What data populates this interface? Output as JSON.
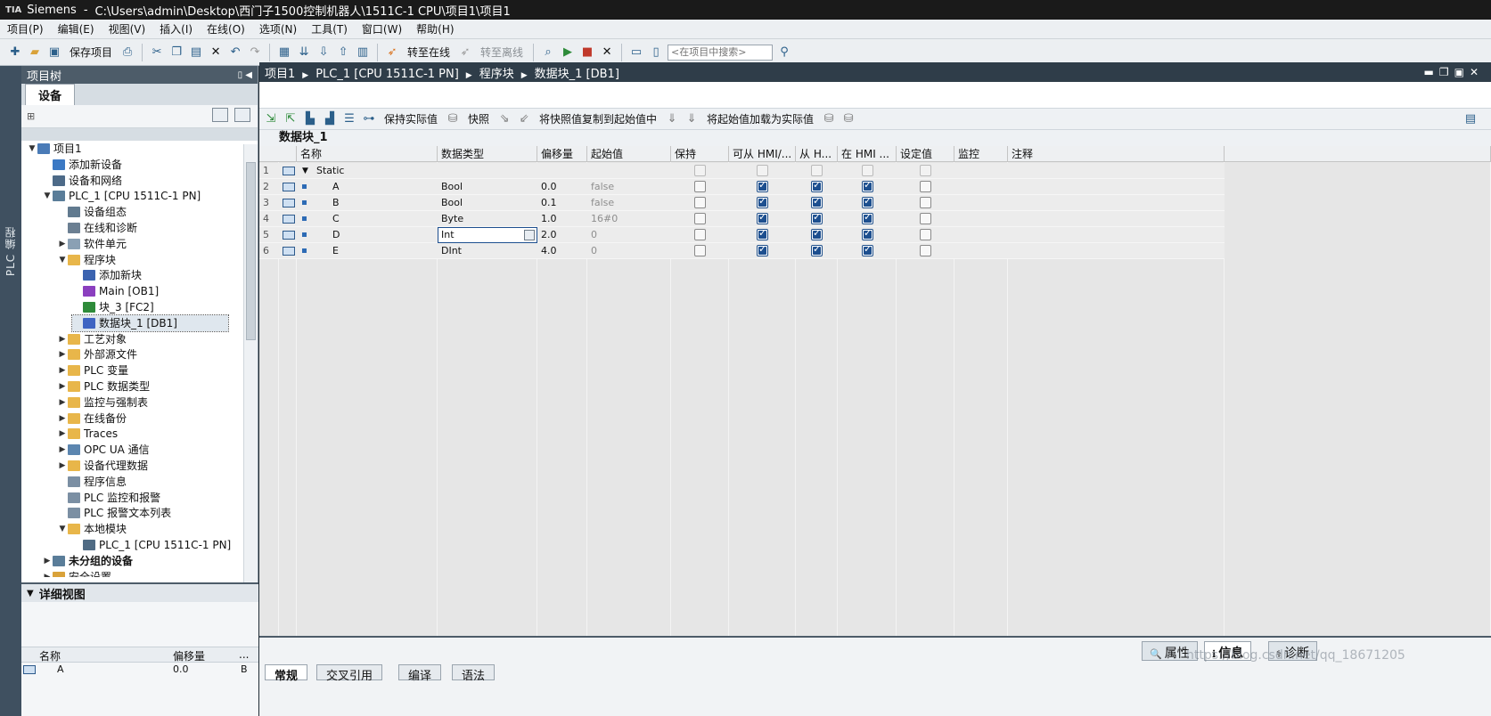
{
  "window": {
    "app": "Siemens",
    "path": "C:\\Users\\admin\\Desktop\\西门子1500控制机器人\\1511C-1 CPU\\项目1\\项目1"
  },
  "menu": [
    "项目(P)",
    "编辑(E)",
    "视图(V)",
    "插入(I)",
    "在线(O)",
    "选项(N)",
    "工具(T)",
    "窗口(W)",
    "帮助(H)"
  ],
  "toolbar": {
    "save_label": "保存项目",
    "go_online": "转至在线",
    "go_offline": "转至离线",
    "search_placeholder": "<在项目中搜索>"
  },
  "vertical_tab": "PLC 编程",
  "tree": {
    "title": "项目树",
    "tab": "设备",
    "items": [
      {
        "label": "项目1",
        "level": 0,
        "expander": "▼",
        "icon": "project-icon",
        "color": "#4a7bb7"
      },
      {
        "label": "添加新设备",
        "level": 1,
        "expander": "",
        "icon": "add-device-icon",
        "color": "#3b79c4"
      },
      {
        "label": "设备和网络",
        "level": 1,
        "expander": "",
        "icon": "network-icon",
        "color": "#4d6a88"
      },
      {
        "label": "PLC_1 [CPU 1511C-1 PN]",
        "level": 1,
        "expander": "▼",
        "icon": "plc-icon",
        "color": "#5a7d99"
      },
      {
        "label": "设备组态",
        "level": 2,
        "expander": "",
        "icon": "device-config-icon",
        "color": "#617a8f"
      },
      {
        "label": "在线和诊断",
        "level": 2,
        "expander": "",
        "icon": "diagnostics-icon",
        "color": "#6b7f92"
      },
      {
        "label": "软件单元",
        "level": 2,
        "expander": "▶",
        "icon": "software-unit-icon",
        "color": "#8aa0b4"
      },
      {
        "label": "程序块",
        "level": 2,
        "expander": "▼",
        "icon": "folder-icon",
        "color": "#e8b64a"
      },
      {
        "label": "添加新块",
        "level": 3,
        "expander": "",
        "icon": "add-block-icon",
        "color": "#3b63b0"
      },
      {
        "label": "Main [OB1]",
        "level": 3,
        "expander": "",
        "icon": "ob-icon",
        "color": "#8b3fbf"
      },
      {
        "label": "块_3 [FC2]",
        "level": 3,
        "expander": "",
        "icon": "fc-icon",
        "color": "#2e8b3a"
      },
      {
        "label": "数据块_1 [DB1]",
        "level": 3,
        "expander": "",
        "icon": "db-icon",
        "color": "#3e64c2"
      },
      {
        "label": "工艺对象",
        "level": 2,
        "expander": "▶",
        "icon": "folder-icon",
        "color": "#e8b64a"
      },
      {
        "label": "外部源文件",
        "level": 2,
        "expander": "▶",
        "icon": "folder-icon",
        "color": "#e8b64a"
      },
      {
        "label": "PLC 变量",
        "level": 2,
        "expander": "▶",
        "icon": "folder-icon",
        "color": "#e8b64a"
      },
      {
        "label": "PLC 数据类型",
        "level": 2,
        "expander": "▶",
        "icon": "folder-icon",
        "color": "#e8b64a"
      },
      {
        "label": "监控与强制表",
        "level": 2,
        "expander": "▶",
        "icon": "folder-icon",
        "color": "#e8b64a"
      },
      {
        "label": "在线备份",
        "level": 2,
        "expander": "▶",
        "icon": "folder-icon",
        "color": "#e8b64a"
      },
      {
        "label": "Traces",
        "level": 2,
        "expander": "▶",
        "icon": "folder-icon",
        "color": "#e8b64a"
      },
      {
        "label": "OPC UA 通信",
        "level": 2,
        "expander": "▶",
        "icon": "opcua-icon",
        "color": "#5c86b0"
      },
      {
        "label": "设备代理数据",
        "level": 2,
        "expander": "▶",
        "icon": "folder-icon",
        "color": "#e8b64a"
      },
      {
        "label": "程序信息",
        "level": 2,
        "expander": "",
        "icon": "program-info-icon",
        "color": "#7b8fa3"
      },
      {
        "label": "PLC 监控和报警",
        "level": 2,
        "expander": "",
        "icon": "alarm-icon",
        "color": "#7b8fa3"
      },
      {
        "label": "PLC 报警文本列表",
        "level": 2,
        "expander": "",
        "icon": "text-list-icon",
        "color": "#7b8fa3"
      },
      {
        "label": "本地模块",
        "level": 2,
        "expander": "▼",
        "icon": "folder-icon",
        "color": "#e8b64a"
      },
      {
        "label": "PLC_1 [CPU 1511C-1 PN]",
        "level": 3,
        "expander": "",
        "icon": "cpu-module-icon",
        "color": "#4f6b84"
      },
      {
        "label": "未分组的设备",
        "level": 1,
        "expander": "▶",
        "icon": "devices-icon",
        "color": "#5a7d99",
        "bold": true
      },
      {
        "label": "安全设置",
        "level": 1,
        "expander": "▶",
        "icon": "security-icon",
        "color": "#d9a23a"
      }
    ]
  },
  "detail": {
    "title": "详细视图",
    "col_name": "名称",
    "col_offset": "偏移量",
    "col_more": "...",
    "row_name": "A",
    "row_offset": "0.0",
    "row_extra": "B"
  },
  "editor": {
    "breadcrumb": [
      "项目1",
      "PLC_1 [CPU 1511C-1 PN]",
      "程序块",
      "数据块_1 [DB1]"
    ],
    "tools": {
      "keep_actual": "保持实际值",
      "snapshot": "快照",
      "copy_snapshot": "将快照值复制到起始值中",
      "load_start": "将起始值加载为实际值"
    },
    "block_title": "数据块_1",
    "columns": [
      "名称",
      "数据类型",
      "偏移量",
      "起始值",
      "保持",
      "可从 HMI/...",
      "从 H...",
      "在 HMI ...",
      "设定值",
      "监控",
      "注释"
    ],
    "rows": [
      {
        "num": "1",
        "name": "Static",
        "type": "",
        "offset": "",
        "start": "",
        "retain": false,
        "hmi_access": false,
        "from_hmi": false,
        "in_hmi": false,
        "setpoint": false,
        "struct": true
      },
      {
        "num": "2",
        "name": "A",
        "type": "Bool",
        "offset": "0.0",
        "start": "false",
        "retain": false,
        "hmi_access": true,
        "from_hmi": true,
        "in_hmi": true,
        "setpoint": false
      },
      {
        "num": "3",
        "name": "B",
        "type": "Bool",
        "offset": "0.1",
        "start": "false",
        "retain": false,
        "hmi_access": true,
        "from_hmi": true,
        "in_hmi": true,
        "setpoint": false
      },
      {
        "num": "4",
        "name": "C",
        "type": "Byte",
        "offset": "1.0",
        "start": "16#0",
        "retain": false,
        "hmi_access": true,
        "from_hmi": true,
        "in_hmi": true,
        "setpoint": false
      },
      {
        "num": "5",
        "name": "D",
        "type": "Int",
        "offset": "2.0",
        "start": "0",
        "retain": false,
        "hmi_access": true,
        "from_hmi": true,
        "in_hmi": true,
        "setpoint": false,
        "editing": true
      },
      {
        "num": "6",
        "name": "E",
        "type": "DInt",
        "offset": "4.0",
        "start": "0",
        "retain": false,
        "hmi_access": true,
        "from_hmi": true,
        "in_hmi": true,
        "setpoint": false
      }
    ]
  },
  "inspector": {
    "tabs": [
      "属性",
      "信息",
      "诊断"
    ],
    "active_tab": "信息",
    "subtabs": [
      "常规",
      "交叉引用",
      "编译",
      "语法"
    ],
    "watermark": "https://blog.csdn.net/qq_18671205"
  }
}
